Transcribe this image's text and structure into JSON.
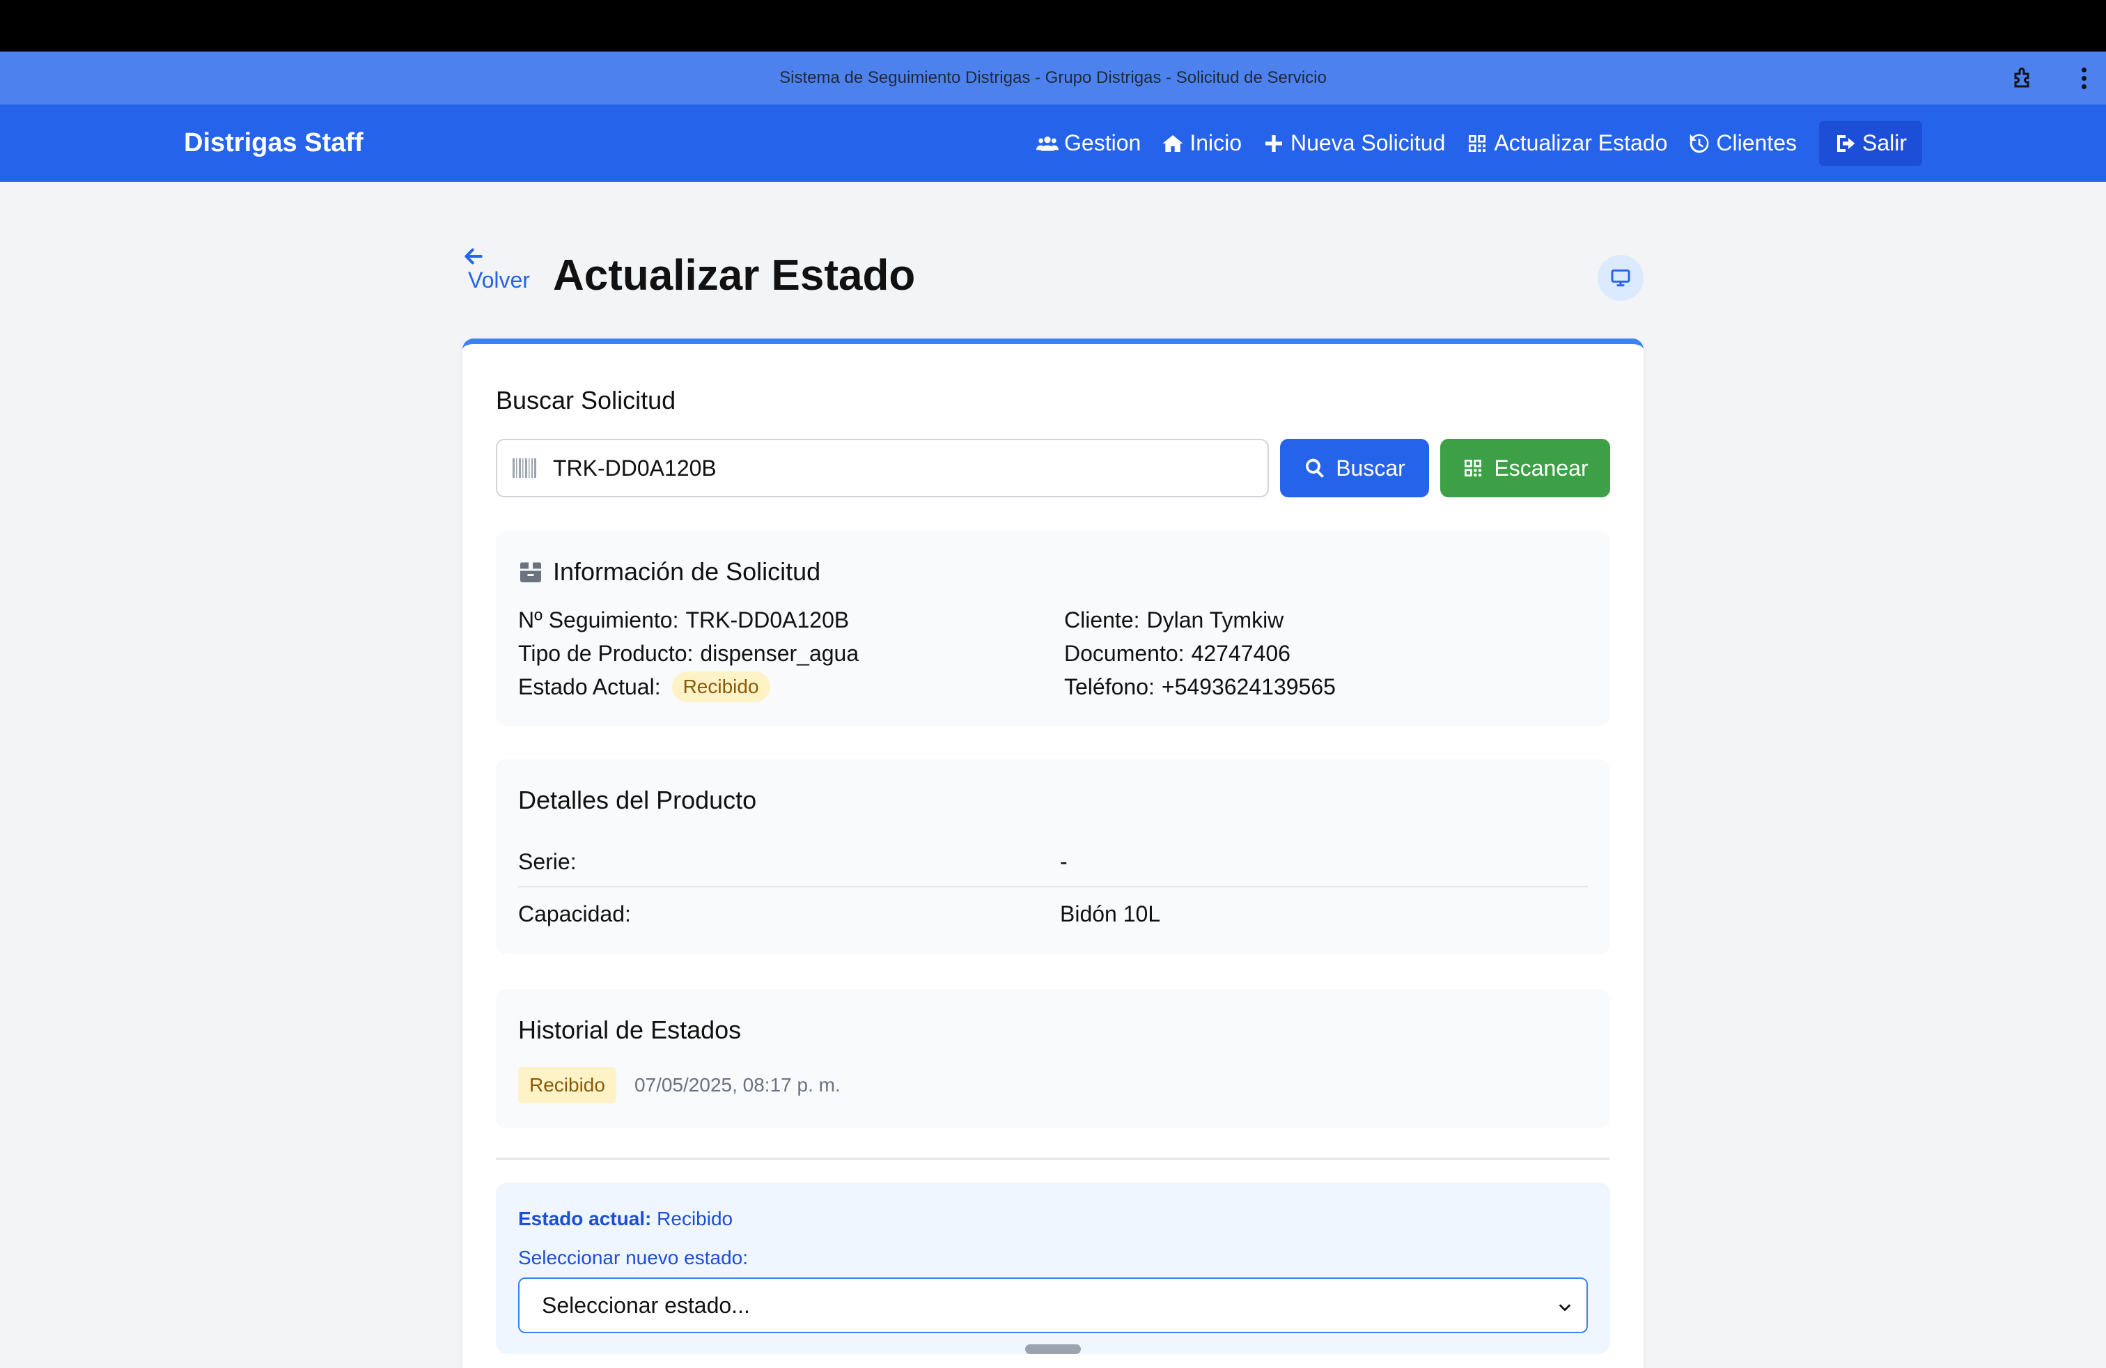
{
  "window": {
    "title": "Sistema de Seguimiento Distrigas - Grupo Distrigas - Solicitud de Servicio"
  },
  "navbar": {
    "brand": "Distrigas Staff",
    "links": [
      {
        "label": "Gestion",
        "icon": "users-icon"
      },
      {
        "label": "Inicio",
        "icon": "home-icon"
      },
      {
        "label": "Nueva Solicitud",
        "icon": "plus-icon"
      },
      {
        "label": "Actualizar Estado",
        "icon": "qrcode-icon"
      },
      {
        "label": "Clientes",
        "icon": "history-icon"
      },
      {
        "label": "Salir",
        "icon": "sign-out-icon"
      }
    ]
  },
  "header": {
    "back_label": "Volver",
    "title": "Actualizar Estado"
  },
  "search": {
    "label": "Buscar Solicitud",
    "value": "TRK-DD0A120B",
    "search_button": "Buscar",
    "scan_button": "Escanear"
  },
  "info": {
    "title": "Información de Solicitud",
    "left": [
      {
        "label": "Nº Seguimiento:",
        "value": "TRK-DD0A120B"
      },
      {
        "label": "Tipo de Producto:",
        "value": "dispenser_agua"
      },
      {
        "label": "Estado Actual:",
        "value": "Recibido"
      }
    ],
    "right": [
      {
        "label": "Cliente:",
        "value": "Dylan Tymkiw"
      },
      {
        "label": "Documento:",
        "value": "42747406"
      },
      {
        "label": "Teléfono:",
        "value": "+5493624139565"
      }
    ]
  },
  "product": {
    "title": "Detalles del Producto",
    "rows": [
      {
        "label": "Serie:",
        "value": "-"
      },
      {
        "label": "Capacidad:",
        "value": "Bidón 10L"
      }
    ]
  },
  "history": {
    "title": "Historial de Estados",
    "entries": [
      {
        "state": "Recibido",
        "time": "07/05/2025, 08:17 p. m."
      }
    ]
  },
  "state_update": {
    "current_label": "Estado actual:",
    "current_value": "Recibido",
    "select_label": "Seleccionar nuevo estado:",
    "select_placeholder": "Seleccionar estado..."
  },
  "colors": {
    "primary": "#2563eb",
    "success": "#3da047",
    "badge_bg": "#fef3c7",
    "badge_text": "#8a5a0b"
  }
}
